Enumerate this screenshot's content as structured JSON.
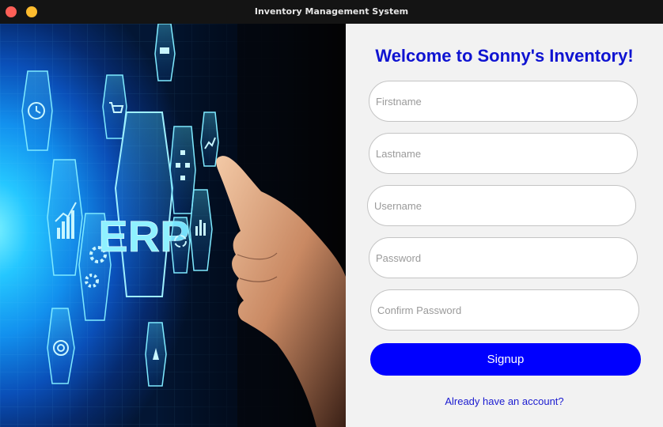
{
  "window": {
    "title": "Inventory Management System"
  },
  "hero": {
    "badge_text": "ERP"
  },
  "form": {
    "heading": "Welcome to Sonny's Inventory!",
    "firstname_placeholder": "Firstname",
    "lastname_placeholder": "Lastname",
    "username_placeholder": "Username",
    "password_placeholder": "Password",
    "confirm_password_placeholder": "Confirm Password",
    "signup_label": "Signup",
    "login_link": "Already have an account?"
  },
  "colors": {
    "heading": "#0f13d1",
    "button": "#0000ff",
    "link": "#1b1bd0",
    "panel_background": "#f2f2f2"
  }
}
